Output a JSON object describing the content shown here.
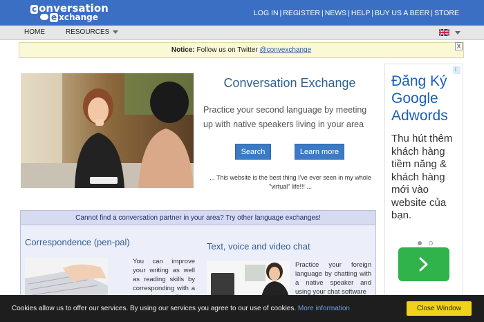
{
  "brand": {
    "logo_line1": "onversation",
    "logo_badge1": "c",
    "logo_line2": "xchange",
    "logo_badge2": "e"
  },
  "topnav": [
    "LOG IN",
    "REGISTER",
    "NEWS",
    "HELP",
    "BUY US A BEER",
    "STORE"
  ],
  "menu": {
    "home": "HOME",
    "resources": "RESOURCES"
  },
  "language_flag": "uk-flag",
  "notice": {
    "label": "Notice:",
    "text": " Follow us on Twitter ",
    "handle": "@convexchange",
    "close": "X"
  },
  "hero": {
    "title": "Conversation Exchange",
    "subtitle": "Practice your second language by meeting up with native speakers living in your area",
    "search_label": "Search",
    "learn_label": "Learn more",
    "quote": "... This website is the best thing I've ever seen in my whole \"virtual\" life!!! ..."
  },
  "ad": {
    "title": "Đăng Ký Google Adwords",
    "body": "Thu hút thêm khách hàng tiềm năng & khách hàng mới vào website của bạn.",
    "info_icon": "i",
    "close_icon": "✕",
    "go_icon": "chevron-right-icon",
    "carousel": {
      "count": 2,
      "active": 0
    }
  },
  "exchanges": {
    "header": "Cannot find a conversation partner in your area? Try other language exchanges!",
    "correspondence": {
      "title": "Correspondence (pen-pal)",
      "text": "You can improve your writing as well as reading skills by corresponding with a penpal . Simply exchange messages with"
    },
    "chat": {
      "title": "Text, voice and video chat",
      "text": "Practice your foreign language by chatting with a native speaker and using your chat software"
    }
  },
  "cookie": {
    "message": "Cookies allow us to offer our services. By using our services you agree to our use of cookies. ",
    "more": "More information",
    "close_label": "Close Window"
  },
  "colors": {
    "header": "#3b6fc4",
    "button": "#3c7bc4",
    "ad_green": "#2fb34a",
    "cookie_btn": "#f1d21a"
  }
}
